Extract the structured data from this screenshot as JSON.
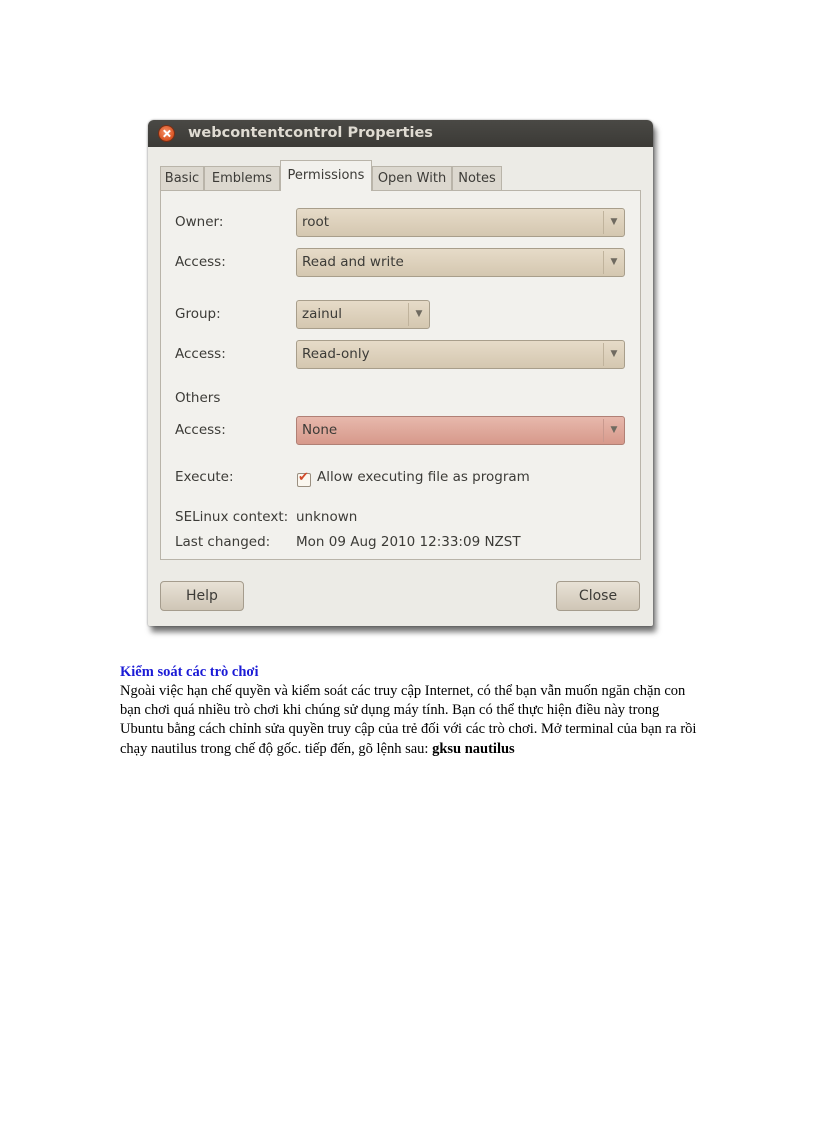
{
  "dialog": {
    "title": "webcontentcontrol Properties",
    "tabs": [
      "Basic",
      "Emblems",
      "Permissions",
      "Open With",
      "Notes"
    ],
    "active_tab": "Permissions",
    "owner": {
      "label": "Owner:",
      "value": "root"
    },
    "owner_access": {
      "label": "Access:",
      "value": "Read and write"
    },
    "group": {
      "label": "Group:",
      "value": "zainul"
    },
    "group_access": {
      "label": "Access:",
      "value": "Read-only"
    },
    "others": {
      "label": "Others"
    },
    "others_access": {
      "label": "Access:",
      "value": "None"
    },
    "execute": {
      "label": "Execute:",
      "checkbox_label": "Allow executing file as program",
      "checked": true
    },
    "selinux": {
      "label": "SELinux context:",
      "value": "unknown"
    },
    "last_changed": {
      "label": "Last changed:",
      "value": "Mon 09 Aug 2010 12:33:09 NZST"
    },
    "help_label": "Help",
    "close_label": "Close",
    "colors": {
      "titlebar": "#3c3b37",
      "close": "#e3582a",
      "warning_combo": "#d9a296"
    }
  },
  "article": {
    "heading": "Kiểm soát các trò chơi",
    "body": "Ngoài việc hạn chế quyền và kiểm soát các truy cập Internet, có thể bạn vẫn muốn ngăn chặn con bạn chơi quá nhiều trò chơi khi chúng sử dụng máy tính. Bạn có thể thực hiện điều này trong Ubuntu bằng cách chỉnh sửa quyền truy cập của trẻ đối với các trò chơi. Mở terminal của bạn ra rồi chạy nautilus trong chế độ gốc. tiếp đến, gõ lệnh sau: ",
    "command": "gksu nautilus",
    "heading_color": "#1b1bd6"
  }
}
